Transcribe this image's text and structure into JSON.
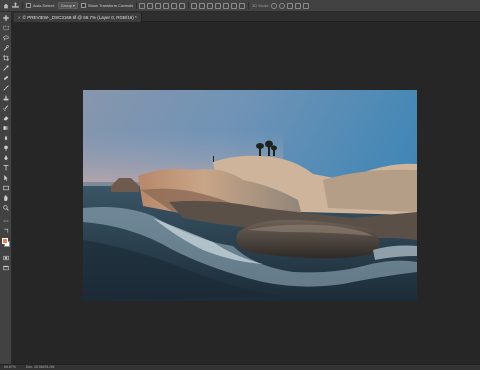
{
  "options_bar": {
    "auto_select_label": "Auto-Select:",
    "auto_select_target": "Group",
    "show_transform_label": "Show Transform Controls",
    "mode_3d_label": "3D Mode:"
  },
  "document": {
    "tab_title": "© PREVIEW-_DSC3169.tif @ 66.7% (Layer 0, RGB/16) *",
    "close_glyph": "×"
  },
  "toolbar": {
    "tools": [
      "move",
      "marquee",
      "lasso",
      "quick-select",
      "crop",
      "eyedropper",
      "spot-heal",
      "brush",
      "clone-stamp",
      "history-brush",
      "eraser",
      "gradient",
      "blur",
      "dodge",
      "pen",
      "type",
      "path-select",
      "shape",
      "hand",
      "zoom",
      "more"
    ],
    "foreground_color": "#e8805c",
    "background_color": "#ffffff"
  },
  "status_bar": {
    "zoom": "66.67%",
    "doc_info": "Doc: 45.5M/91.0M"
  }
}
